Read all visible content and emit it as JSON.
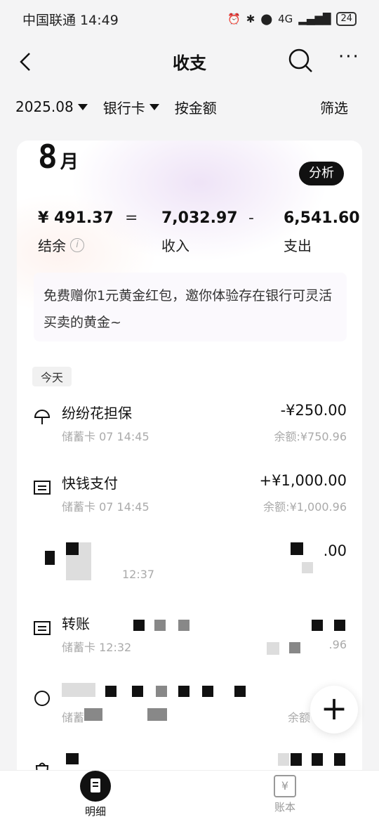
{
  "status_bar": {
    "carrier_time": "中国联通 14:49",
    "battery": "24",
    "network": "4G"
  },
  "nav": {
    "title": "收支"
  },
  "filters": {
    "month": "2025.08",
    "account": "银行卡",
    "sort": "按金额",
    "filter": "筛选"
  },
  "summary": {
    "month_num": "8",
    "month_suffix": "月",
    "analysis_label": "分析",
    "balance_value": "¥ 491.37",
    "balance_label": "结余",
    "equals": "=",
    "income_value": "7,032.97",
    "income_label": "收入",
    "minus": "-",
    "expense_value": "6,541.60",
    "expense_label": "支出"
  },
  "promo": {
    "text": "免费赠你1元黄金红包，邀你体验存在银行可灵活买卖的黄金~"
  },
  "day_chip": "今天",
  "transactions": [
    {
      "title": "纷纷花担保",
      "sub": "储蓄卡 07 14:45",
      "amount": "-¥250.00",
      "balance": "余额:¥750.96",
      "icon": "umbrella-icon"
    },
    {
      "title": "快钱支付",
      "sub": "储蓄卡 07 14:45",
      "amount": "+¥1,000.00",
      "balance": "余额:¥1,000.96",
      "icon": "transfer-icon"
    },
    {
      "title": "",
      "sub": "12:37",
      "amount": ".00",
      "balance": "",
      "icon": "card-icon"
    },
    {
      "title": "转账",
      "sub": "储蓄卡 12:32",
      "amount": "",
      "balance": ".96",
      "icon": "transfer-icon"
    },
    {
      "title": "",
      "sub": "储蓄",
      "amount": "",
      "balance": "余额",
      "icon": "clock-icon"
    },
    {
      "title": "",
      "sub": "",
      "amount": "",
      "balance": "",
      "icon": "bag-icon"
    }
  ],
  "fab": {
    "label": "+"
  },
  "tabbar": {
    "detail_label": "明细",
    "ledger_label": "账本"
  }
}
